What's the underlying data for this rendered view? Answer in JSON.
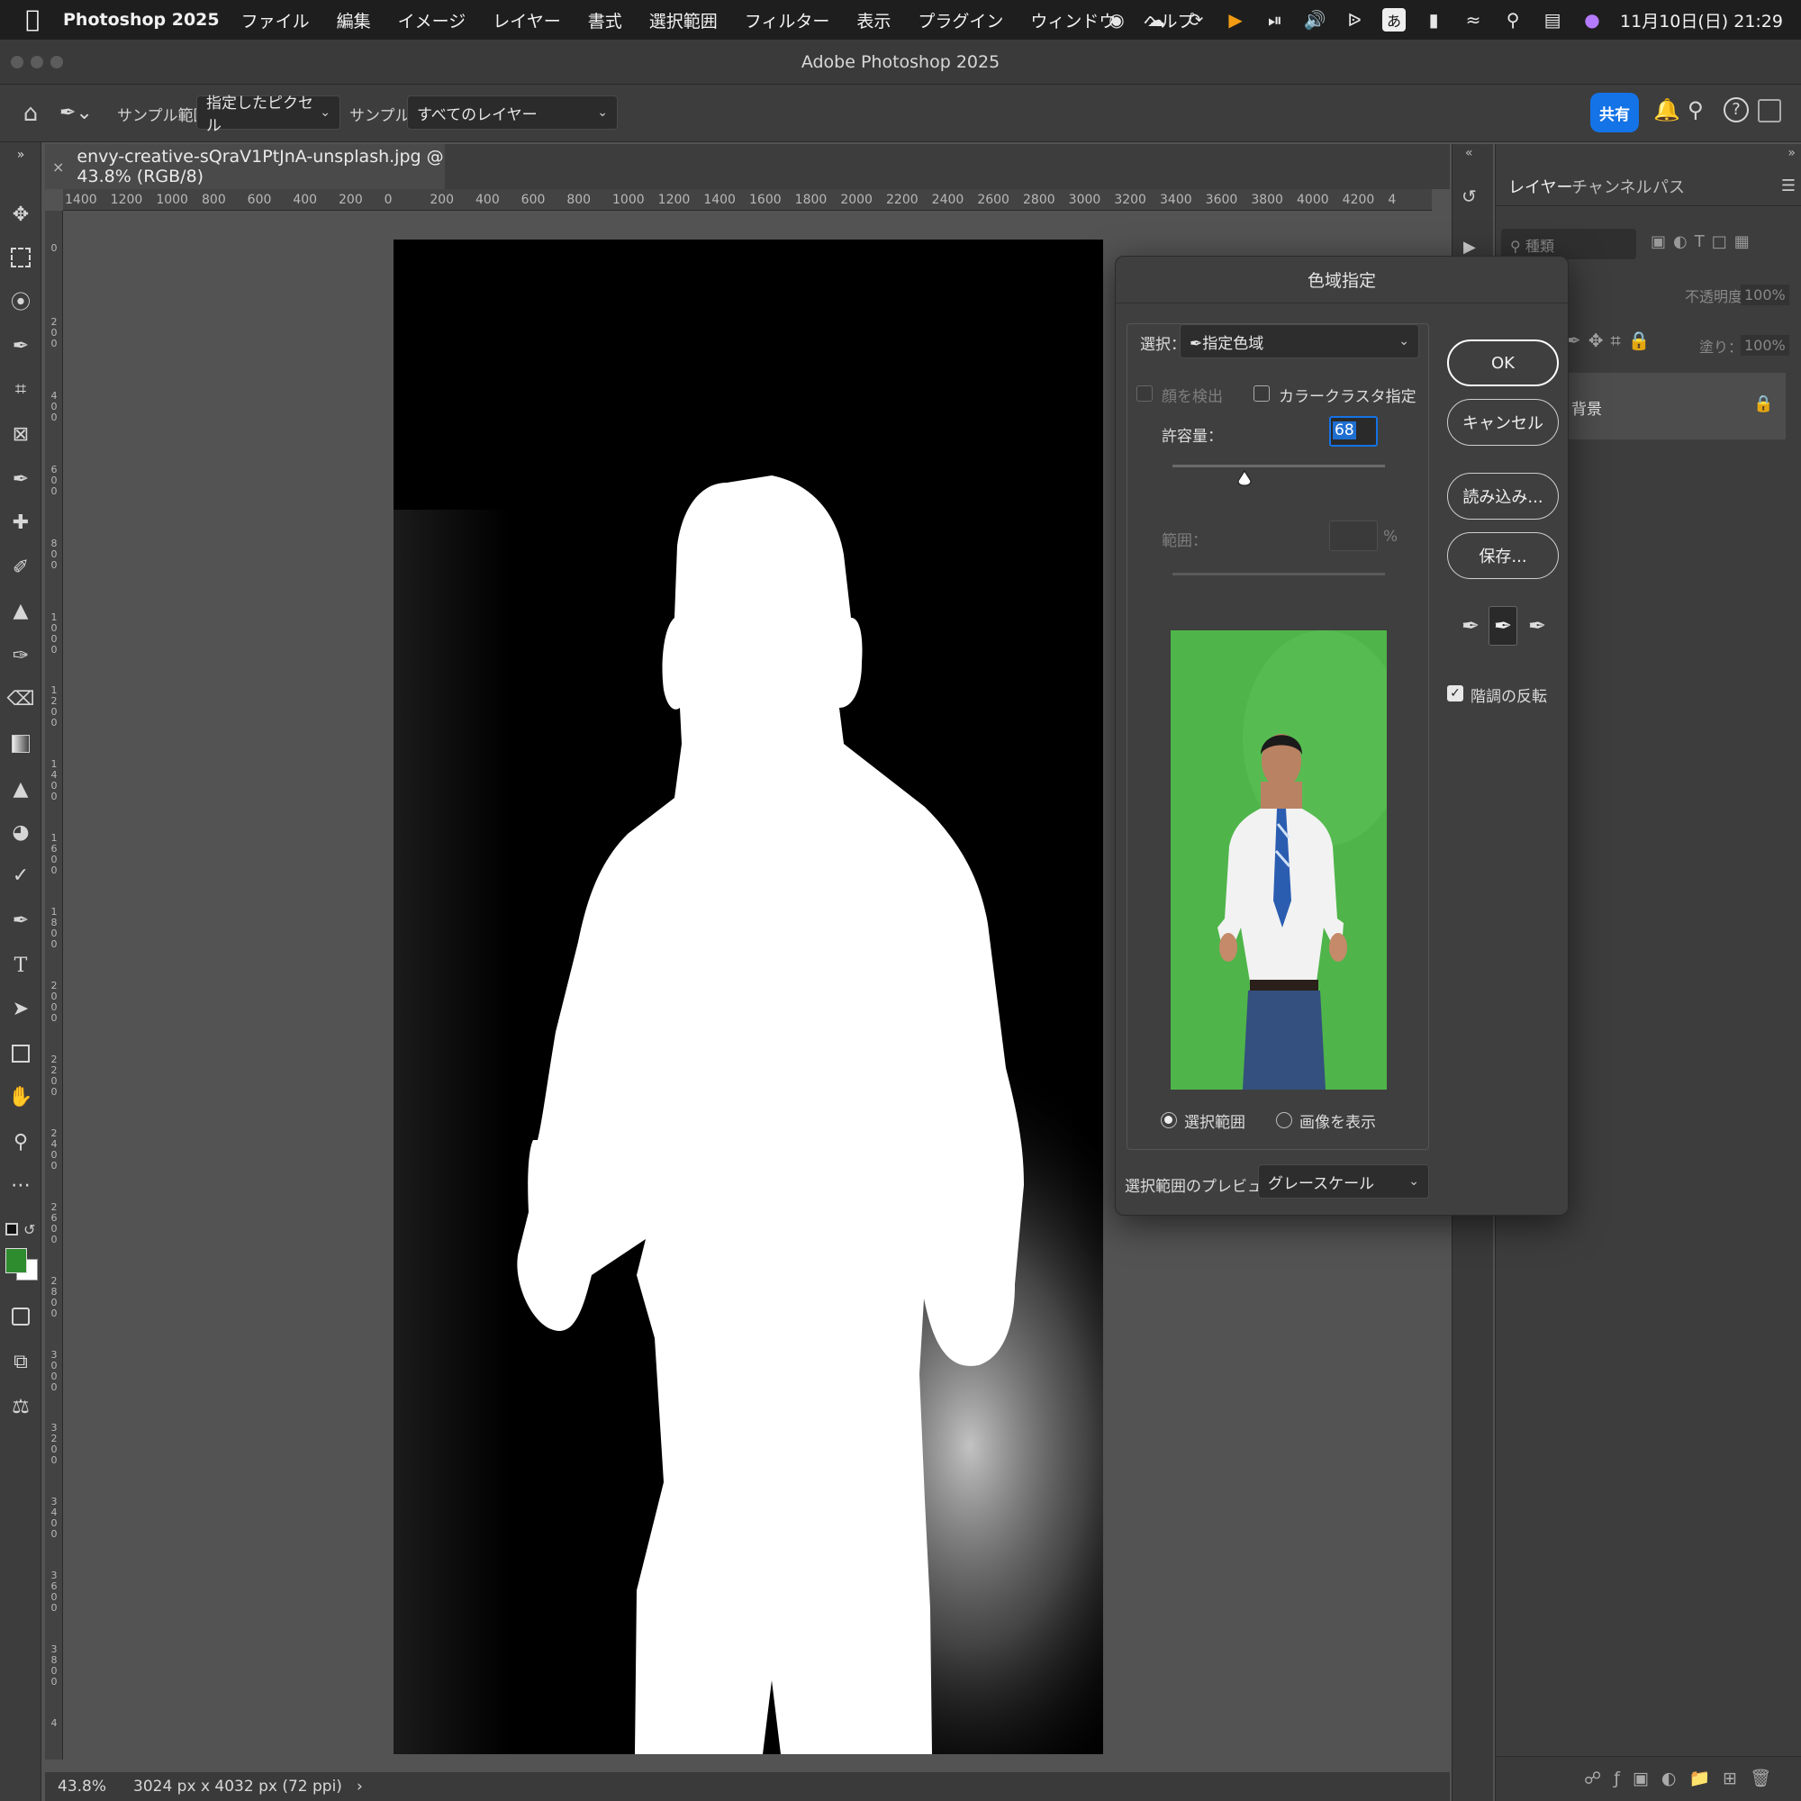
{
  "menubar": {
    "app_name": "Photoshop 2025",
    "items": [
      "ファイル",
      "編集",
      "イメージ",
      "レイヤー",
      "書式",
      "選択範囲",
      "フィルター",
      "表示",
      "プラグイン",
      "ウィンドウ",
      "ヘルプ"
    ],
    "ime_label": "あ",
    "datetime": "11月10日(日) 21:29"
  },
  "window": {
    "title": "Adobe Photoshop 2025"
  },
  "options": {
    "sample_range_label": "サンプル範囲：",
    "sample_range_value": "指定したピクセル",
    "sample_label": "サンプル：",
    "sample_value": "すべてのレイヤー",
    "share_label": "共有"
  },
  "document": {
    "tab_title": "envy-creative-sQraV1PtJnA-unsplash.jpg @ 43.8% (RGB/8)",
    "close_glyph": "×"
  },
  "ruler": {
    "h_ticks": [
      "1400",
      "1200",
      "1000",
      "800",
      "600",
      "400",
      "200",
      "0",
      "200",
      "400",
      "600",
      "800",
      "1000",
      "1200",
      "1400",
      "1600",
      "1800",
      "2000",
      "2200",
      "2400",
      "2600",
      "2800",
      "3000",
      "3200",
      "3400",
      "3600",
      "3800",
      "4000",
      "4200",
      "4"
    ],
    "v_ticks": [
      "0",
      "200",
      "400",
      "600",
      "800",
      "1000",
      "1200",
      "1400",
      "1600",
      "1800",
      "2000",
      "2200",
      "2400",
      "2600",
      "2800",
      "3000",
      "3200",
      "3400",
      "3600",
      "3800",
      "4"
    ]
  },
  "status": {
    "zoom": "43.8%",
    "dimensions": "3024 px x 4032 px (72 ppi)",
    "arrow": "›"
  },
  "layers_panel": {
    "tabs": [
      "レイヤー",
      "チャンネル",
      "パス"
    ],
    "search_placeholder": "種類",
    "opacity_label": "不透明度：",
    "opacity_value": "100%",
    "fill_label": "塗り：",
    "fill_value": "100%",
    "layer_name": "背景"
  },
  "dialog": {
    "title": "色域指定",
    "select_label": "選択：",
    "select_value": "指定色域",
    "detect_faces": "顔を検出",
    "localized_clusters": "カラークラスタ指定",
    "fuzziness_label": "許容量：",
    "fuzziness_value": "68",
    "fuzziness_max": 200,
    "range_label": "範囲：",
    "range_unit": "%",
    "ok": "OK",
    "cancel": "キャンセル",
    "load": "読み込み...",
    "save": "保存...",
    "invert": "階調の反転",
    "invert_checked": true,
    "radio_selection": "選択範囲",
    "radio_image": "画像を表示",
    "radio_selected": "selection",
    "preview_label": "選択範囲のプレビュー：",
    "preview_value": "グレースケール"
  },
  "colors": {
    "accent": "#1473e6",
    "foreground_swatch": "#2e8b2e",
    "background_swatch": "#ffffff",
    "greenscreen": "#4fb54a",
    "canvas_bg": "#000000"
  }
}
